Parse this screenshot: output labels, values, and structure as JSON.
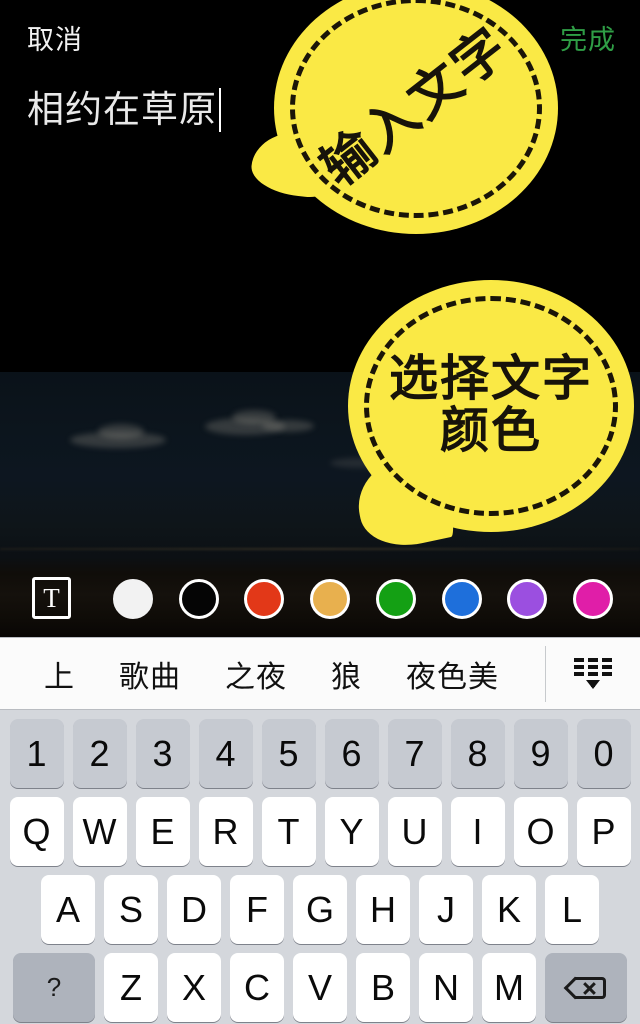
{
  "topbar": {
    "cancel_label": "取消",
    "done_label": "完成",
    "done_color": "#2f9e46"
  },
  "caption": {
    "text": "相约在草原",
    "cursor_visible": true
  },
  "bubbles": [
    {
      "id": "input-text",
      "text": "输入文字",
      "fill": "#fae945",
      "ink": "#17130a"
    },
    {
      "id": "select-color",
      "line1": "选择文字",
      "line2": "颜色",
      "fill": "#fae945",
      "ink": "#17130a"
    }
  ],
  "toolbar": {
    "text_tool_label": "T",
    "swatches": [
      {
        "name": "white",
        "color": "#f2f2f2",
        "ring": "#f2f2f2",
        "selected": true
      },
      {
        "name": "black",
        "color": "#050505",
        "ring": "#ffffff",
        "selected": false
      },
      {
        "name": "red",
        "color": "#e23818",
        "ring": "#ffffff",
        "selected": false
      },
      {
        "name": "orange",
        "color": "#e8b04e",
        "ring": "#ffffff",
        "selected": false
      },
      {
        "name": "green",
        "color": "#14a014",
        "ring": "#ffffff",
        "selected": false
      },
      {
        "name": "blue",
        "color": "#1e6fdb",
        "ring": "#ffffff",
        "selected": false
      },
      {
        "name": "purple",
        "color": "#9b4fe0",
        "ring": "#ffffff",
        "selected": false
      },
      {
        "name": "magenta",
        "color": "#e01ea8",
        "ring": "#ffffff",
        "selected": false
      }
    ]
  },
  "keyboard": {
    "suggestions": [
      "上",
      "歌曲",
      "之夜",
      "狼",
      "夜色美"
    ],
    "collapse_icon": "keyboard-collapse-icon",
    "rows": {
      "numbers": [
        "1",
        "2",
        "3",
        "4",
        "5",
        "6",
        "7",
        "8",
        "9",
        "0"
      ],
      "row1": [
        "Q",
        "W",
        "E",
        "R",
        "T",
        "Y",
        "U",
        "I",
        "O",
        "P"
      ],
      "row2": [
        "A",
        "S",
        "D",
        "F",
        "G",
        "H",
        "J",
        "K",
        "L"
      ],
      "row3": [
        "Z",
        "X",
        "C",
        "V",
        "B",
        "N",
        "M"
      ]
    },
    "shift_label": "?",
    "backspace_icon": "backspace-icon"
  }
}
